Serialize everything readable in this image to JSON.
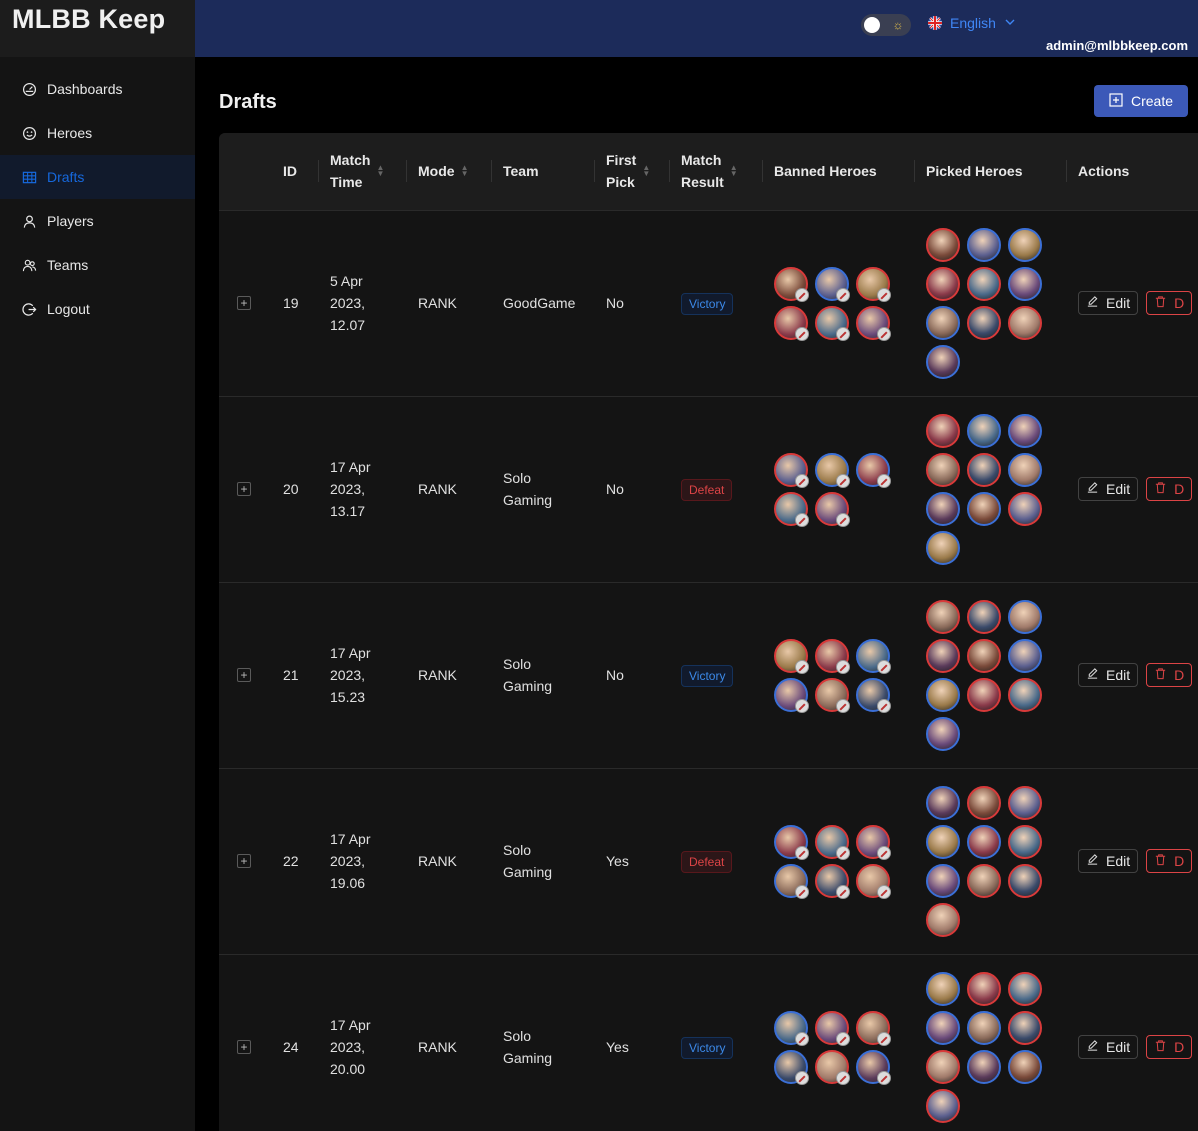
{
  "app": {
    "title": "MLBB Keep"
  },
  "sidebar": {
    "items": [
      {
        "label": "Dashboards",
        "icon": "dashboard-icon",
        "active": false
      },
      {
        "label": "Heroes",
        "icon": "smile-icon",
        "active": false
      },
      {
        "label": "Drafts",
        "icon": "table-icon",
        "active": true
      },
      {
        "label": "Players",
        "icon": "user-icon",
        "active": false
      },
      {
        "label": "Teams",
        "icon": "team-icon",
        "active": false
      },
      {
        "label": "Logout",
        "icon": "logout-icon",
        "active": false
      }
    ]
  },
  "header": {
    "language": "English",
    "user_email": "admin@mlbbkeep.com"
  },
  "page": {
    "title": "Drafts",
    "create_label": "Create"
  },
  "table": {
    "columns": {
      "id": "ID",
      "match_time_1": "Match",
      "match_time_2": "Time",
      "mode": "Mode",
      "team": "Team",
      "first_pick_1": "First",
      "first_pick_2": "Pick",
      "match_result_1": "Match",
      "match_result_2": "Result",
      "banned": "Banned Heroes",
      "picked": "Picked Heroes",
      "actions": "Actions"
    },
    "edit_label": "Edit",
    "delete_label": "D",
    "rows": [
      {
        "id": "19",
        "time1": "5 Apr",
        "time2": "2023,",
        "time3": "12.07",
        "mode": "RANK",
        "team1": "GoodGame",
        "team2": "",
        "first_pick": "No",
        "result": "Victory"
      },
      {
        "id": "20",
        "time1": "17 Apr",
        "time2": "2023,",
        "time3": "13.17",
        "mode": "RANK",
        "team1": "Solo",
        "team2": "Gaming",
        "first_pick": "No",
        "result": "Defeat"
      },
      {
        "id": "21",
        "time1": "17 Apr",
        "time2": "2023,",
        "time3": "15.23",
        "mode": "RANK",
        "team1": "Solo",
        "team2": "Gaming",
        "first_pick": "No",
        "result": "Victory"
      },
      {
        "id": "22",
        "time1": "17 Apr",
        "time2": "2023,",
        "time3": "19.06",
        "mode": "RANK",
        "team1": "Solo",
        "team2": "Gaming",
        "first_pick": "Yes",
        "result": "Defeat"
      },
      {
        "id": "24",
        "time1": "17 Apr",
        "time2": "2023,",
        "time3": "20.00",
        "mode": "RANK",
        "team1": "Solo",
        "team2": "Gaming",
        "first_pick": "Yes",
        "result": "Victory"
      }
    ]
  },
  "colors": {
    "header_bg": "#1c2b5a",
    "accent": "#3c59b8",
    "victory": "#3c89e8",
    "defeat": "#dc4446",
    "team_blue_border": "#3b6fd6",
    "team_red_border": "#d83a3a"
  }
}
